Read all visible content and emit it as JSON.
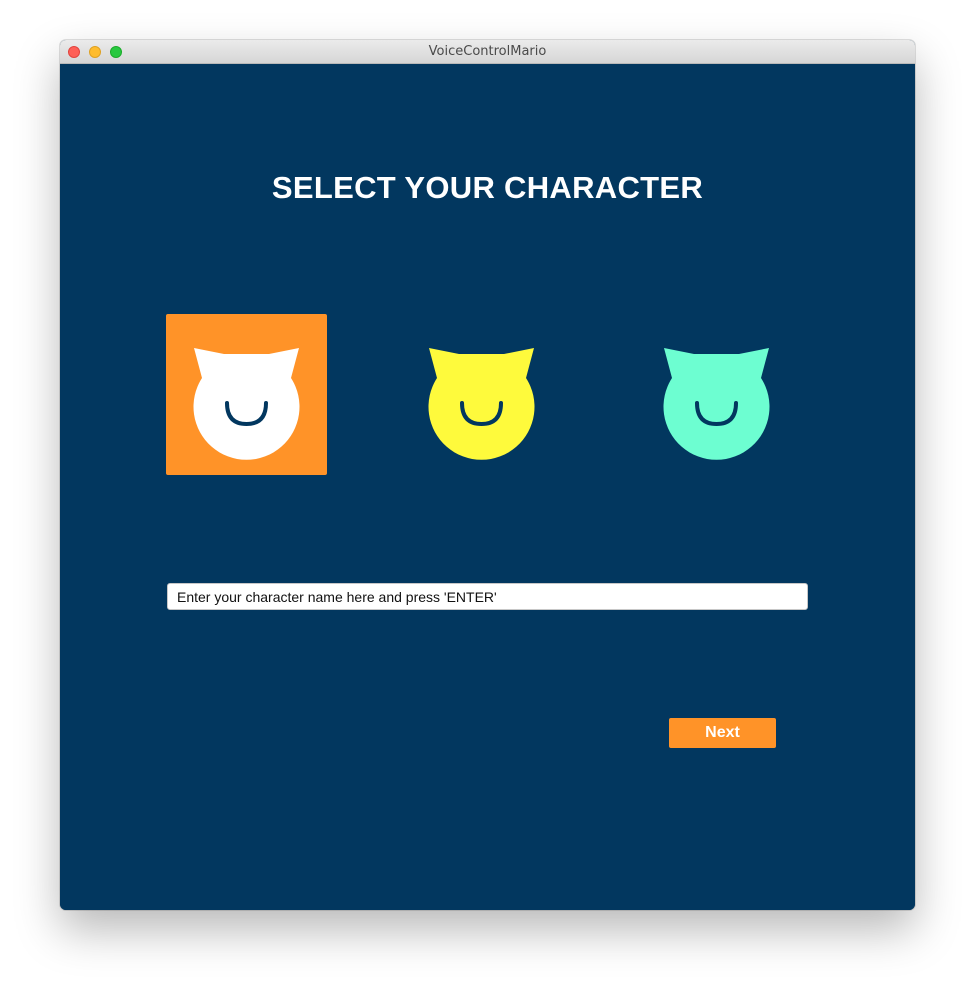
{
  "window": {
    "title": "VoiceControlMario"
  },
  "page": {
    "title": "SELECT YOUR CHARACTER"
  },
  "characters": [
    {
      "icon": "cat-face-icon",
      "color": "#ffffff",
      "selected": true,
      "tile_color": "#ff9328"
    },
    {
      "icon": "cat-face-icon",
      "color": "#fefa3c",
      "selected": false
    },
    {
      "icon": "cat-face-icon",
      "color": "#6dfed1",
      "selected": false
    }
  ],
  "name_input": {
    "value": "",
    "placeholder": "Enter your character name here and press 'ENTER'"
  },
  "next_button": {
    "label": "Next"
  },
  "colors": {
    "background": "#02375f",
    "accent": "#ff9328",
    "smile": "#02375f"
  }
}
